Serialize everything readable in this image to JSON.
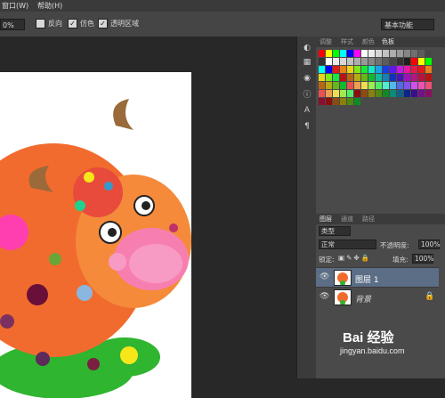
{
  "menu": {
    "window": "窗口(W)",
    "help": "帮助(H)"
  },
  "options": {
    "zoom_fraction": "0%",
    "invert": "反向",
    "dither": "仿色",
    "transparency": "透明区域",
    "workspace": "基本功能"
  },
  "panel_tabs_top": [
    "调整",
    "样式",
    "颜色",
    "色板"
  ],
  "panel_tabs_layers": [
    "图层",
    "通道",
    "路径"
  ],
  "layers_panel": {
    "kind_filter": "类型",
    "blend_mode": "正常",
    "opacity_label": "不透明度:",
    "opacity_value": "100%",
    "lock_label": "锁定:",
    "fill_label": "填充:",
    "fill_value": "100%",
    "layers": [
      {
        "name": "图层 1",
        "selected": true
      },
      {
        "name": "背景",
        "selected": false,
        "locked": true
      }
    ]
  },
  "watermark": {
    "brand": "Bai 经验",
    "url": "jingyan.baidu.com"
  },
  "swatch_colors": [
    "#ff0000",
    "#ffff00",
    "#00ff00",
    "#00ffff",
    "#0000ff",
    "#ff00ff",
    "#ffffff",
    "#ebebeb",
    "#d6d6d6",
    "#c2c2c2",
    "#adadad",
    "#999999",
    "#858585",
    "#707070",
    "#5c5c5c",
    "#474747",
    "#333333",
    "#1f1f1f"
  ]
}
